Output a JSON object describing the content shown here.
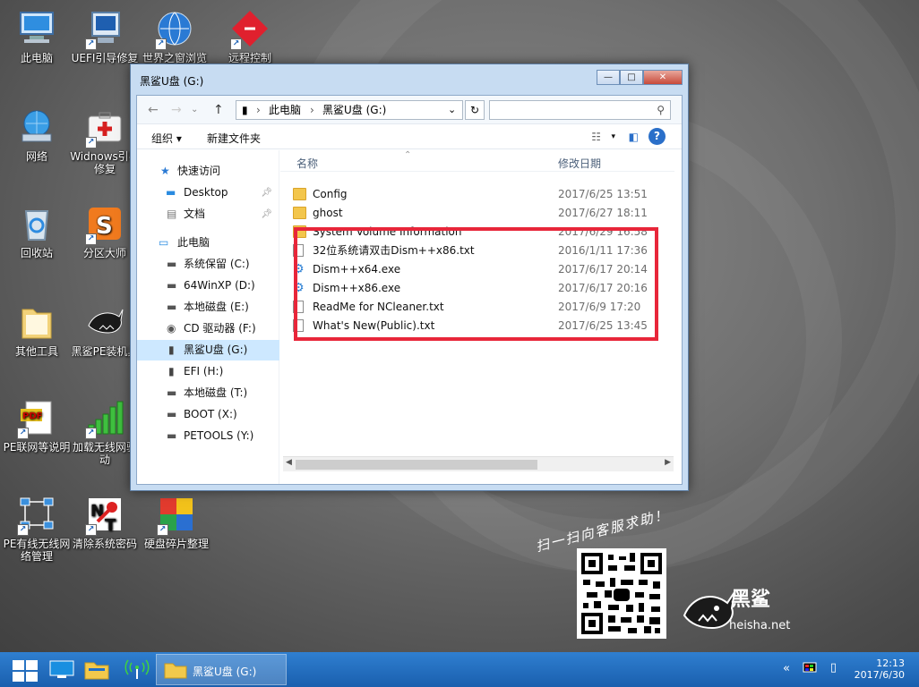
{
  "desktop": {
    "icons": [
      {
        "label": "此电脑"
      },
      {
        "label": "UEFI引导修复"
      },
      {
        "label": "世界之窗浏览"
      },
      {
        "label": "远程控制"
      },
      {
        "label": "网络"
      },
      {
        "label": "Widnows引导修复"
      },
      {
        "label": "回收站"
      },
      {
        "label": "分区大师"
      },
      {
        "label": "其他工具"
      },
      {
        "label": "黑鲨PE装机具"
      },
      {
        "label": "PE联网等说明"
      },
      {
        "label": "加载无线网驱动"
      },
      {
        "label": "PE有线无线网络管理"
      },
      {
        "label": "清除系统密码"
      },
      {
        "label": "硬盘碎片整理"
      }
    ],
    "qr_caption": "扫一扫向客服求助！",
    "brand_name": "黑鲨",
    "brand_site": "heisha.net"
  },
  "window": {
    "title": "黑鲨U盘 (G:)",
    "breadcrumb": [
      "此电脑",
      "黑鲨U盘 (G:)"
    ],
    "search_placeholder": "",
    "toolbar": {
      "organize": "组织",
      "new_folder": "新建文件夹"
    },
    "nav": {
      "quick_access": "快速访问",
      "quick_items": [
        "Desktop",
        "文档"
      ],
      "this_pc": "此电脑",
      "drives": [
        "系统保留 (C:)",
        "64WinXP  (D:)",
        "本地磁盘 (E:)",
        "CD 驱动器 (F:)",
        "黑鲨U盘 (G:)",
        "EFI (H:)",
        "本地磁盘 (T:)",
        "BOOT (X:)",
        "PETOOLS (Y:)"
      ]
    },
    "columns": {
      "name": "名称",
      "date": "修改日期"
    },
    "files": [
      {
        "name": "Config",
        "date": "2017/6/25 13:51",
        "type": "folder"
      },
      {
        "name": "ghost",
        "date": "2017/6/27 18:11",
        "type": "folder"
      },
      {
        "name": "System Volume Information",
        "date": "2017/6/29 16:58",
        "type": "folder"
      },
      {
        "name": "32位系统请双击Dism++x86.txt",
        "date": "2016/1/11 17:36",
        "type": "txt"
      },
      {
        "name": "Dism++x64.exe",
        "date": "2017/6/17 20:14",
        "type": "exe"
      },
      {
        "name": "Dism++x86.exe",
        "date": "2017/6/17 20:16",
        "type": "exe"
      },
      {
        "name": "ReadMe for NCleaner.txt",
        "date": "2017/6/9 17:20",
        "type": "txt"
      },
      {
        "name": "What's New(Public).txt",
        "date": "2017/6/25 13:45",
        "type": "txt"
      }
    ]
  },
  "taskbar": {
    "active_window": "黑鲨U盘 (G:)",
    "time": "12:13",
    "date": "2017/6/30"
  }
}
